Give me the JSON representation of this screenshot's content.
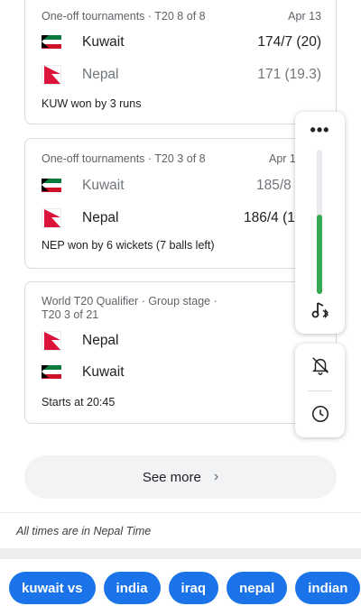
{
  "matches": [
    {
      "header": "One-off tournaments · T20 8 of 8",
      "date": "Apr 13",
      "teams": [
        {
          "name": "Kuwait",
          "flag": "kuwait-flag",
          "score": "174/7 (20)",
          "winner": true
        },
        {
          "name": "Nepal",
          "flag": "nepal-flag",
          "score": "171 (19.3)",
          "winner": false
        }
      ],
      "result": "KUW won by 3 runs"
    },
    {
      "header": "One-off tournaments · T20 3 of 8",
      "date": "Apr 1",
      "teams": [
        {
          "name": "Kuwait",
          "flag": "kuwait-flag",
          "score": "185/8",
          "winner": false
        },
        {
          "name": "Nepal",
          "flag": "nepal-flag",
          "score": "186/4 (1",
          "winner": true
        }
      ],
      "result": "NEP won by 6 wickets (7 balls left)"
    },
    {
      "header_line1": "World T20 Qualifier · Group stage ·",
      "header_line2": "T20 3 of 21",
      "teams": [
        {
          "name": "Nepal",
          "flag": "nepal-flag"
        },
        {
          "name": "Kuwait",
          "flag": "kuwait-flag"
        }
      ],
      "result": "Starts at 20:45"
    }
  ],
  "see_more": {
    "label": "See more",
    "chevron": "›"
  },
  "footnote": "All times are in Nepal Time",
  "chips": [
    "kuwait vs",
    "india",
    "iraq",
    "nepal",
    "indian"
  ],
  "panel": {
    "menu_glyph": "•••",
    "volume_level": 0.55,
    "accent": "#34a853",
    "icons": [
      "bluetooth-music-icon",
      "bell-off-icon",
      "clock-icon"
    ]
  }
}
